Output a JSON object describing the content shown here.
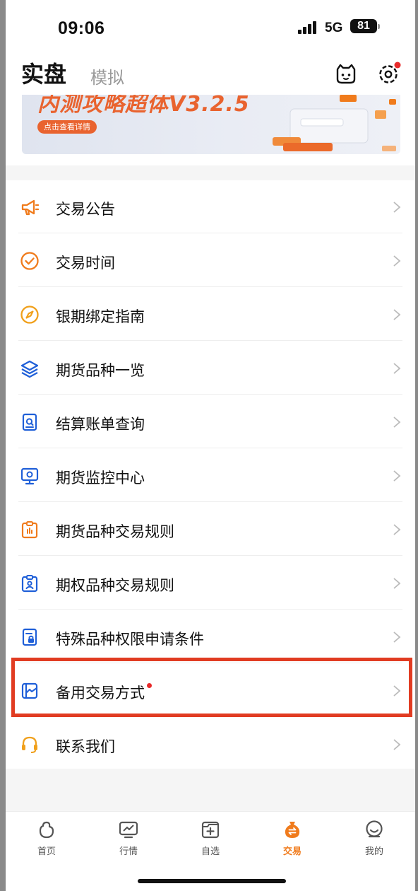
{
  "status_bar": {
    "time": "09:06",
    "network": "5G",
    "battery": "81"
  },
  "header": {
    "tab_real": "实盘",
    "tab_sim": "模拟",
    "settings_badge": true
  },
  "banner": {
    "title": "内测攻略超体V3.2.5",
    "button": "点击查看详情"
  },
  "menu": [
    {
      "label": "交易公告",
      "icon": "megaphone-icon",
      "color": "#f07b1c"
    },
    {
      "label": "交易时间",
      "icon": "clock-check-icon",
      "color": "#f07b1c"
    },
    {
      "label": "银期绑定指南",
      "icon": "compass-icon",
      "color": "#f0a01c"
    },
    {
      "label": "期货品种一览",
      "icon": "layers-icon",
      "color": "#1f5fd8"
    },
    {
      "label": "结算账单查询",
      "icon": "bill-search-icon",
      "color": "#1f5fd8"
    },
    {
      "label": "期货监控中心",
      "icon": "monitor-icon",
      "color": "#1f5fd8"
    },
    {
      "label": "期货品种交易规则",
      "icon": "clipboard-rule-icon",
      "color": "#f07b1c"
    },
    {
      "label": "期权品种交易规则",
      "icon": "clipboard-user-icon",
      "color": "#1f5fd8"
    },
    {
      "label": "特殊品种权限申请条件",
      "icon": "doc-lock-icon",
      "color": "#1f5fd8"
    },
    {
      "label": "备用交易方式",
      "icon": "chart-frame-icon",
      "color": "#1f5fd8",
      "badge": true
    },
    {
      "label": "联系我们",
      "icon": "headset-icon",
      "color": "#f0a01c"
    }
  ],
  "tabbar": [
    {
      "label": "首页",
      "icon": "home-icon"
    },
    {
      "label": "行情",
      "icon": "market-icon"
    },
    {
      "label": "自选",
      "icon": "watchlist-icon"
    },
    {
      "label": "交易",
      "icon": "trade-icon",
      "active": true
    },
    {
      "label": "我的",
      "icon": "profile-icon"
    }
  ],
  "colors": {
    "accent": "#f07b1c",
    "highlight": "#e13c22",
    "blue": "#1f5fd8"
  }
}
